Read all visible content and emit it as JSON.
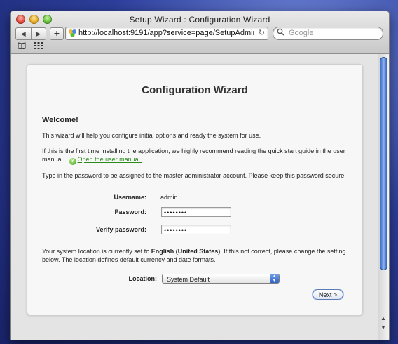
{
  "window": {
    "title": "Setup Wizard : Configuration Wizard"
  },
  "toolbar": {
    "back_icon": "◀",
    "forward_icon": "▶",
    "add_icon": "+",
    "url": "http://localhost:9191/app?service=page/SetupAdmin",
    "reload_icon": "↻",
    "search_placeholder": "Google"
  },
  "wizard": {
    "title": "Configuration Wizard",
    "welcome_heading": "Welcome!",
    "intro": "This wizard will help you configure initial options and ready the system for use.",
    "manual_text": "If this is the first time installing the application, we highly recommend reading the quick start guide in the user manual.",
    "manual_link": "Open the user manual.",
    "password_instructions": "Type in the password to be assigned to the master administrator account. Please keep this password secure.",
    "username_label": "Username:",
    "username_value": "admin",
    "password_label": "Password:",
    "password_value": "••••••••",
    "verify_label": "Verify password:",
    "verify_value": "••••••••",
    "location_text_before": "Your system location is currently set to",
    "location_current": "English (United States)",
    "location_text_after": ". If this not correct, please change the setting below. The location defines default currency and date formats.",
    "location_label": "Location:",
    "location_selected": "System Default",
    "next_label": "Next >"
  }
}
